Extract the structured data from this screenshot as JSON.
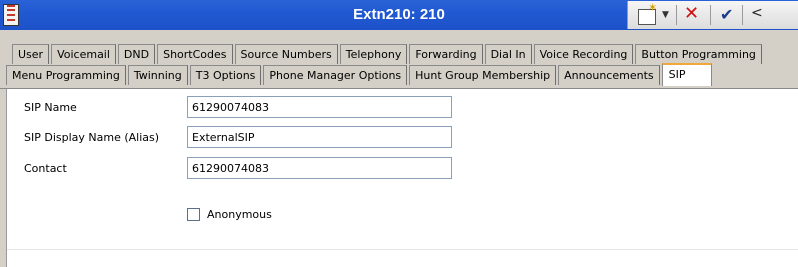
{
  "window": {
    "title": "Extn210: 210"
  },
  "toolbar": {
    "new_icon": "new-file-icon",
    "dropdown_icon": "dropdown-icon",
    "close_icon": "close-x-icon",
    "check_icon": "check-icon",
    "back_icon": "back-icon"
  },
  "tabs": {
    "row1": [
      "User",
      "Voicemail",
      "DND",
      "ShortCodes",
      "Source Numbers",
      "Telephony",
      "Forwarding",
      "Dial In",
      "Voice Recording",
      "Button Programming"
    ],
    "row2": [
      "Menu Programming",
      "Twinning",
      "T3 Options",
      "Phone Manager Options",
      "Hunt Group Membership",
      "Announcements",
      "SIP"
    ],
    "active": "SIP"
  },
  "form": {
    "sip_name_label": "SIP Name",
    "sip_name_value": "61290074083",
    "display_name_label": "SIP Display Name (Alias)",
    "display_name_value": "ExternalSIP",
    "contact_label": "Contact",
    "contact_value": "61290074083",
    "anonymous_label": "Anonymous",
    "anonymous_checked": false
  }
}
